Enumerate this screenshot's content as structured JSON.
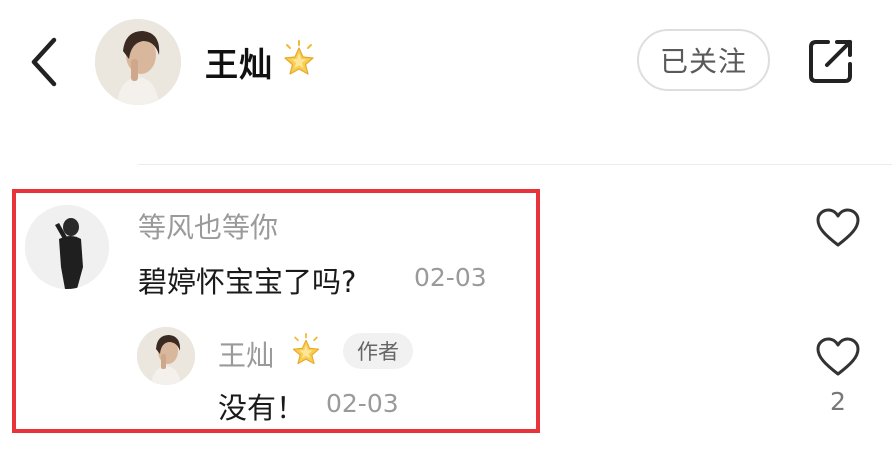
{
  "header": {
    "title": "王灿",
    "follow_label": "已关注"
  },
  "comment": {
    "username": "等风也等你",
    "text": "碧婷怀宝宝了吗?",
    "date": "02-03",
    "reply": {
      "username": "王灿",
      "badge": "作者",
      "text": "没有！",
      "date": "02-03",
      "likes": "2"
    }
  },
  "colors": {
    "highlight": "#e8333b",
    "muted_text": "#9a9a9a",
    "star": "#f5c542"
  },
  "icons": [
    "back-arrow-icon",
    "star-badge-icon",
    "share-icon",
    "heart-icon"
  ]
}
